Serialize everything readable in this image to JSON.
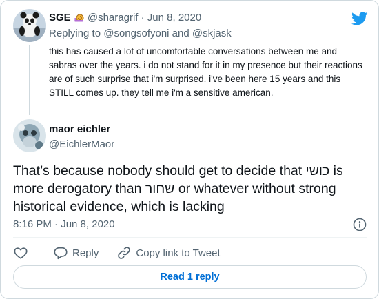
{
  "tweet_parent": {
    "display_name": "SGE",
    "emoji": "snail-icon",
    "handle": "@sharagrif",
    "separator": "·",
    "date": "Jun 8, 2020",
    "replying_prefix": "Replying to ",
    "replying_user_1": "@songsofyoni",
    "replying_and": " and ",
    "replying_user_2": "@skjask",
    "text": "this has caused a lot of uncomfortable conversations between me and sabras over the years. i do not stand for it in my presence but their reactions are of such surprise that i'm surprised. i've been here 15 years and this STILL comes up. they tell me i'm a sensitive american."
  },
  "tweet_main": {
    "display_name": "maor eichler",
    "handle": "@EichlerMaor",
    "text": "That’s because nobody should get to decide that כושי is more derogatory than שחור or whatever without strong historical evidence, which is lacking",
    "timestamp": "8:16 PM · Jun 8, 2020"
  },
  "actions": {
    "like_icon": "heart-icon",
    "reply_label": "Reply",
    "copy_link_label": "Copy link to Tweet"
  },
  "read_replies_label": "Read 1 reply",
  "colors": {
    "brand": "#1d9bf0",
    "link": "#006fd6",
    "muted": "#536471",
    "text": "#0f1419",
    "border": "#cfd9de"
  }
}
